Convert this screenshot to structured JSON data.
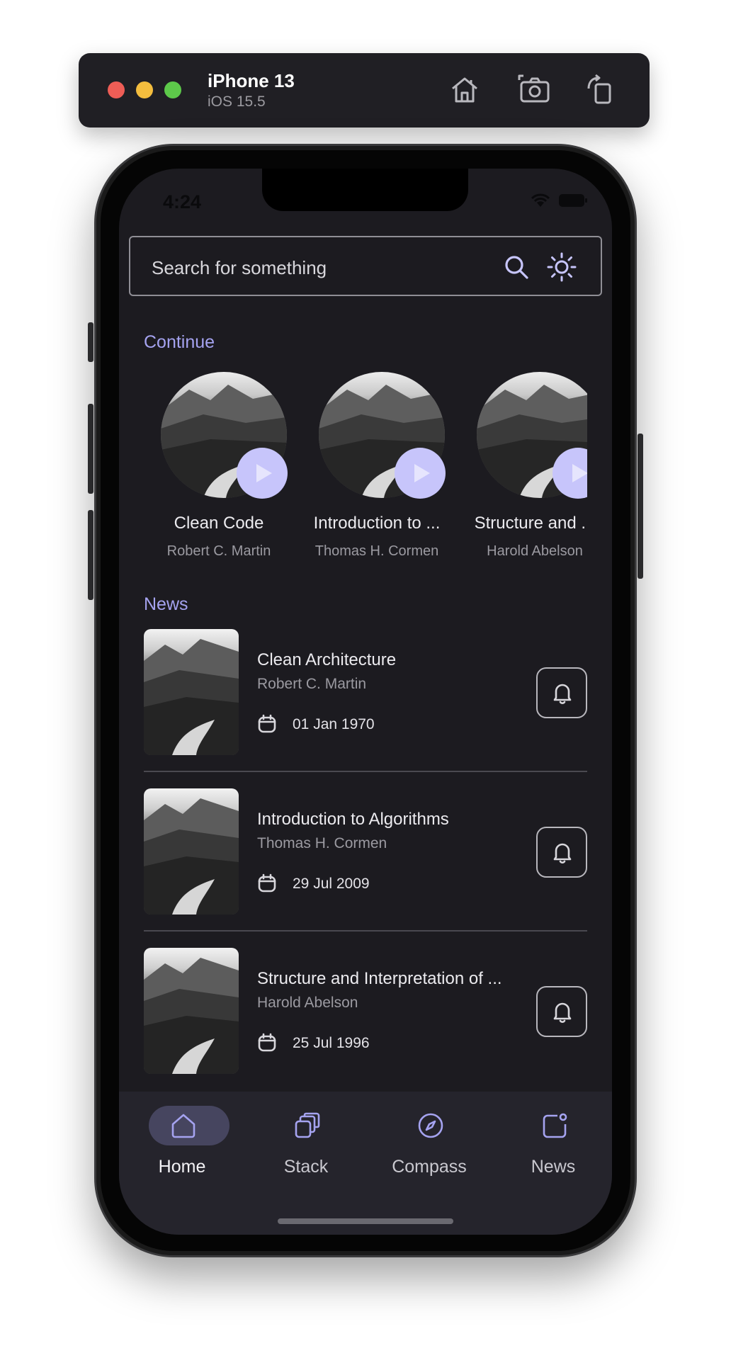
{
  "simulator": {
    "device_name": "iPhone 13",
    "os_version": "iOS 15.5",
    "buttons": [
      "home-icon",
      "screenshot-icon",
      "rotate-icon"
    ]
  },
  "status_bar": {
    "time": "4:24"
  },
  "search": {
    "placeholder": "Search for something"
  },
  "continue": {
    "title": "Continue",
    "items": [
      {
        "title": "Clean Code",
        "author": "Robert C. Martin"
      },
      {
        "title": "Introduction to ...",
        "author": "Thomas H. Cormen"
      },
      {
        "title": "Structure and ...",
        "author": "Harold Abelson"
      }
    ]
  },
  "news": {
    "title": "News",
    "items": [
      {
        "title": "Clean Architecture",
        "author": "Robert C. Martin",
        "date": "01 Jan 1970"
      },
      {
        "title": "Introduction to Algorithms",
        "author": "Thomas H. Cormen",
        "date": "29 Jul 2009"
      },
      {
        "title": "Structure and Interpretation of ...",
        "author": "Harold Abelson",
        "date": "25 Jul 1996"
      }
    ]
  },
  "bottom_nav": {
    "items": [
      {
        "label": "Home",
        "icon": "home-icon",
        "active": true
      },
      {
        "label": "Stack",
        "icon": "stack-icon",
        "active": false
      },
      {
        "label": "Compass",
        "icon": "compass-icon",
        "active": false
      },
      {
        "label": "News",
        "icon": "news-icon",
        "active": false
      }
    ]
  },
  "colors": {
    "accent": "#a5a3f0",
    "play_button": "#c7c5fb",
    "background": "#1c1b20",
    "nav_background": "#25242c",
    "nav_active_pill": "#46455f"
  }
}
